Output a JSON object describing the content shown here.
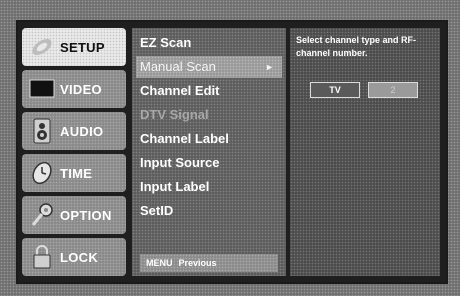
{
  "tabs": [
    {
      "label": "SETUP",
      "icon": "setup-icon",
      "active": true
    },
    {
      "label": "VIDEO",
      "icon": "video-icon"
    },
    {
      "label": "AUDIO",
      "icon": "audio-icon"
    },
    {
      "label": "TIME",
      "icon": "time-icon"
    },
    {
      "label": "OPTION",
      "icon": "option-icon"
    },
    {
      "label": "LOCK",
      "icon": "lock-icon"
    }
  ],
  "menu": {
    "items": [
      {
        "label": "EZ Scan"
      },
      {
        "label": "Manual Scan",
        "selected": true,
        "arrow": "►"
      },
      {
        "label": "Channel Edit"
      },
      {
        "label": "DTV Signal",
        "disabled": true
      },
      {
        "label": "Channel Label"
      },
      {
        "label": "Input Source"
      },
      {
        "label": "Input Label"
      },
      {
        "label": "SetID"
      }
    ],
    "footer": {
      "key": "MENU",
      "action": "Previous"
    }
  },
  "panel": {
    "description": "Select channel type and RF-channel number.",
    "channel_type": "TV",
    "channel_number": "2"
  },
  "colors": {
    "active_tab": "#e9e9e9",
    "inactive_tab": "#8a8a8a",
    "selected_item": "#9a9a9a",
    "disabled_text": "#a8a8a8"
  }
}
